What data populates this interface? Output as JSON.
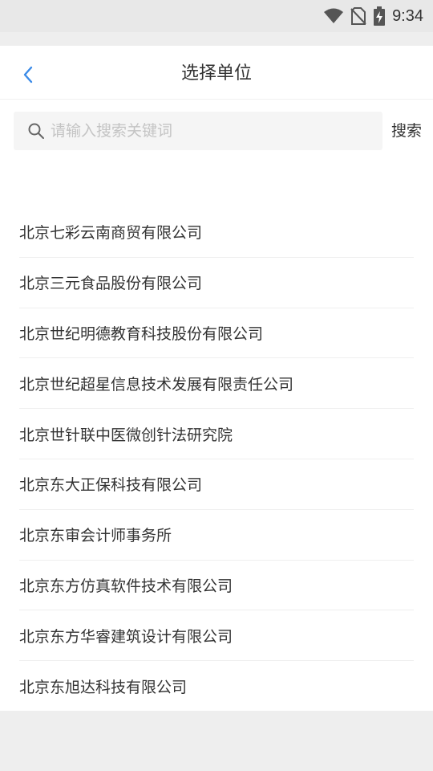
{
  "status_bar": {
    "time": "9:34",
    "icons": [
      "wifi-icon",
      "no-sim-icon",
      "battery-charging-icon"
    ]
  },
  "header": {
    "title": "选择单位",
    "back_icon": "chevron-left-icon"
  },
  "search": {
    "placeholder": "请输入搜索关键词",
    "value": "",
    "button_label": "搜索",
    "icon": "search-icon"
  },
  "companies": [
    "北京七彩云南商贸有限公司",
    "北京三元食品股份有限公司",
    "北京世纪明德教育科技股份有限公司",
    "北京世纪超星信息技术发展有限责任公司",
    "北京世针联中医微创针法研究院",
    "北京东大正保科技有限公司",
    "北京东审会计师事务所",
    "北京东方仿真软件技术有限公司",
    "北京东方华睿建筑设计有限公司",
    "北京东旭达科技有限公司"
  ],
  "colors": {
    "accent": "#3b8be8",
    "text": "#333333",
    "placeholder": "#c4c4c4",
    "background": "#eeeeee"
  }
}
